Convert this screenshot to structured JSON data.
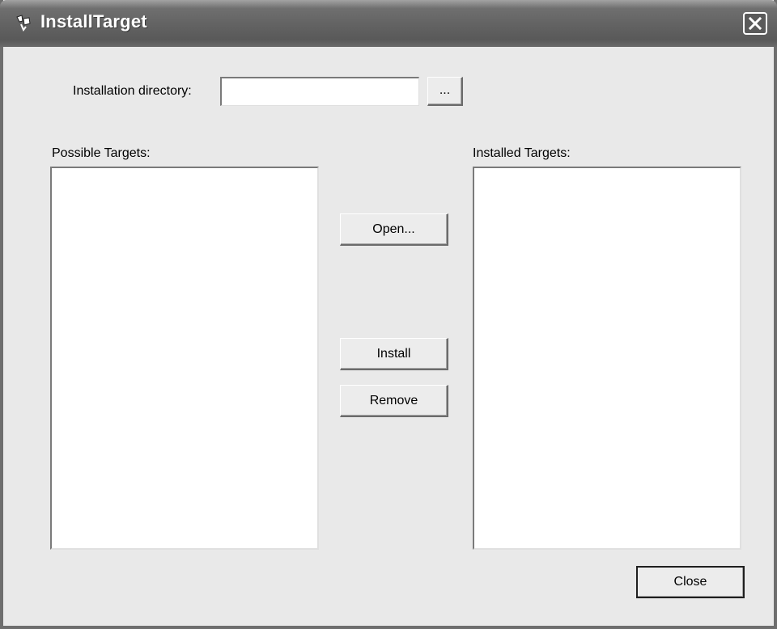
{
  "window": {
    "title": "InstallTarget",
    "icon": "app-icon",
    "close_icon": "close-icon"
  },
  "form": {
    "install_dir_label": "Installation directory:",
    "install_dir_value": "",
    "browse_label": "...",
    "possible_label": "Possible Targets:",
    "installed_label": "Installed Targets:",
    "open_label": "Open...",
    "install_label": "Install",
    "remove_label": "Remove",
    "close_label": "Close"
  },
  "lists": {
    "possible": [],
    "installed": []
  }
}
